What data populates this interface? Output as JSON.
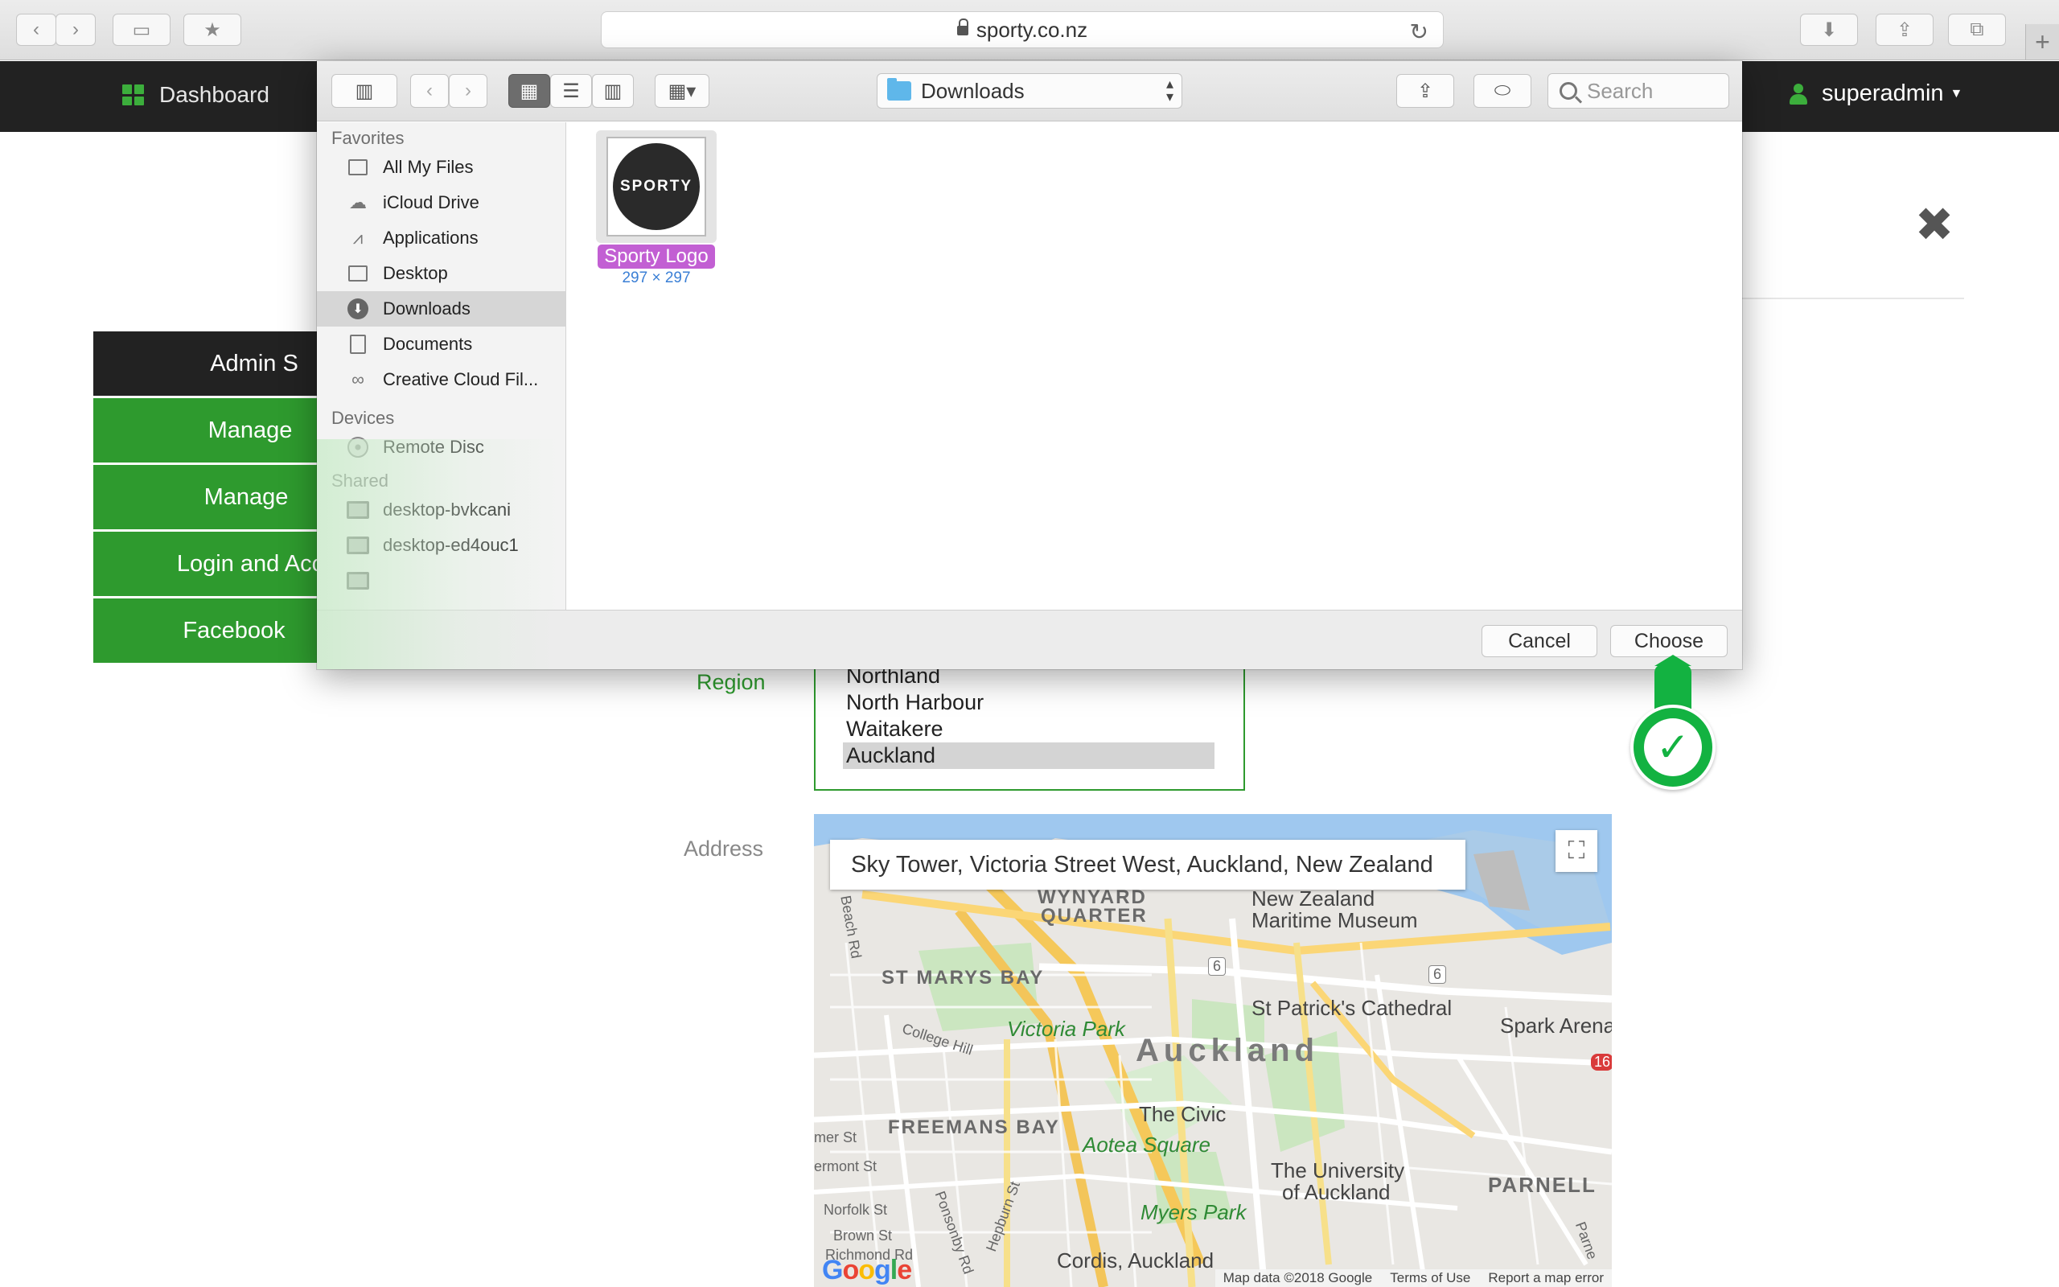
{
  "browser": {
    "url": "sporty.co.nz",
    "back_icon": "chevron-left-icon",
    "forward_icon": "chevron-right-icon"
  },
  "app_nav": {
    "dashboard_label": "Dashboard",
    "user_label": "superadmin"
  },
  "side_menu": {
    "items": [
      {
        "label": "Admin S"
      },
      {
        "label": "Manage"
      },
      {
        "label": "Manage"
      },
      {
        "label": "Login and Acc"
      },
      {
        "label": "Facebook"
      }
    ]
  },
  "form": {
    "region_label": "Region",
    "address_label": "Address",
    "region_options": [
      "Northland",
      "North Harbour",
      "Waitakere",
      "Auckland"
    ],
    "region_selected": "Auckland"
  },
  "map": {
    "search_value": "Sky Tower, Victoria Street West, Auckland, New Zealand",
    "labels": {
      "wynyard": "WYNYARD",
      "quarter": "QUARTER",
      "maritime1": "New Zealand",
      "maritime2": "Maritime Museum",
      "st_marys": "ST MARYS BAY",
      "victoria_park": "Victoria Park",
      "st_patricks": "St Patrick's Cathedral",
      "spark": "Spark Arena",
      "auckland": "Auckland",
      "college_hill": "College Hill",
      "freemans": "FREEMANS BAY",
      "the_civic": "The Civic",
      "aotea": "Aotea Square",
      "university1": "The University",
      "university2": "of Auckland",
      "parnell": "PARNELL",
      "myers": "Myers Park",
      "cordis": "Cordis, Auckland",
      "beach_rd": "Beach Rd",
      "ponsonby": "Ponsonby Rd",
      "hepburn": "Hepburn St",
      "norfolk": "Norfolk St",
      "brown": "Brown St",
      "richmond": "Richmond Rd",
      "summer": "mer St",
      "vermont": "ermont St",
      "route6a": "6",
      "route6b": "6",
      "route16": "16",
      "parnell_rd": "Parne"
    },
    "google_logo": "Google",
    "footer": {
      "data": "Map data ©2018 Google",
      "terms": "Terms of Use",
      "report": "Report a map error"
    }
  },
  "dialog": {
    "location": "Downloads",
    "search_placeholder": "Search",
    "sidebar": {
      "favorites_heading": "Favorites",
      "favorites": [
        {
          "label": "All My Files",
          "icon": "all-files-icon"
        },
        {
          "label": "iCloud Drive",
          "icon": "cloud-icon"
        },
        {
          "label": "Applications",
          "icon": "applications-icon"
        },
        {
          "label": "Desktop",
          "icon": "desktop-icon"
        },
        {
          "label": "Downloads",
          "icon": "downloads-icon"
        },
        {
          "label": "Documents",
          "icon": "documents-icon"
        },
        {
          "label": "Creative Cloud Fil...",
          "icon": "creative-cloud-icon"
        }
      ],
      "devices_heading": "Devices",
      "devices": [
        {
          "label": "Remote Disc",
          "icon": "disc-icon"
        }
      ],
      "shared_heading": "Shared",
      "shared": [
        {
          "label": "desktop-bvkcani",
          "icon": "monitor-icon"
        },
        {
          "label": "desktop-ed4ouc1",
          "icon": "monitor-icon"
        }
      ]
    },
    "file": {
      "name": "Sporty Logo",
      "dims": "297 × 297",
      "thumb_text": "SPORTY"
    },
    "cancel_label": "Cancel",
    "choose_label": "Choose"
  },
  "colors": {
    "brand_green": "#2e9a2e",
    "nav_dark": "#222222",
    "selection_purple": "#c25fd3",
    "badge_green": "#13b241"
  }
}
